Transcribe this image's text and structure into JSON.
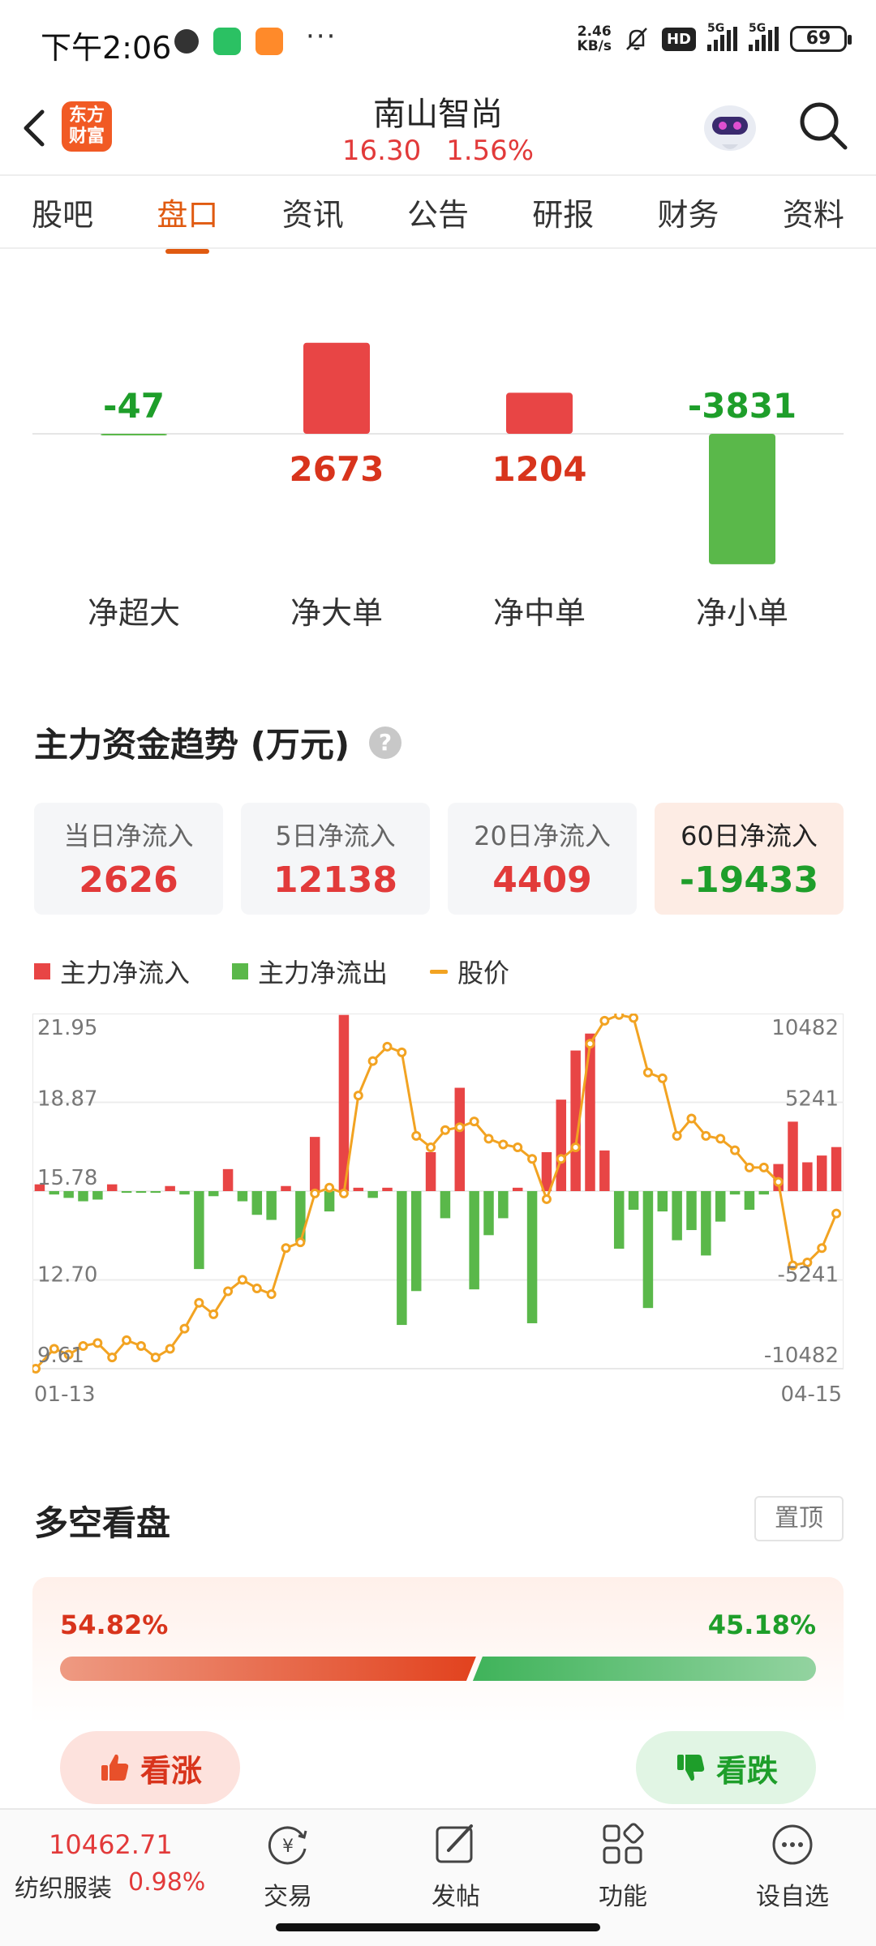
{
  "status_bar": {
    "time": "下午2:06",
    "net_speed_value": "2.46",
    "net_speed_unit": "KB/s",
    "hd_badge": "HD",
    "signal_1_tag": "5G",
    "signal_2_tag": "5G",
    "battery": "69"
  },
  "header": {
    "logo_text": "东方财富",
    "stock_name": "南山智尚",
    "price": "16.30",
    "change_pct": "1.56%"
  },
  "tabs": [
    "股吧",
    "盘口",
    "资讯",
    "公告",
    "研报",
    "财务",
    "资料"
  ],
  "active_tab": "盘口",
  "net_orders": [
    {
      "label": "净超大",
      "value": "-47"
    },
    {
      "label": "净大单",
      "value": "2673"
    },
    {
      "label": "净中单",
      "value": "1204"
    },
    {
      "label": "净小单",
      "value": "-3831"
    }
  ],
  "trend": {
    "title": "主力资金趋势 (万元)",
    "help_icon": "?",
    "cards": [
      {
        "label": "当日净流入",
        "value": "2626"
      },
      {
        "label": "5日净流入",
        "value": "12138"
      },
      {
        "label": "20日净流入",
        "value": "4409"
      },
      {
        "label": "60日净流入",
        "value": "-19433"
      }
    ],
    "legend": {
      "inflow": "主力净流入",
      "outflow": "主力净流出",
      "price": "股价"
    },
    "colors": {
      "red": "#e84545",
      "green": "#5ab84a",
      "price": "#f2a322"
    }
  },
  "chart_data": {
    "type": "bar",
    "x_start": "01-13",
    "x_end": "04-15",
    "left_axis_ticks": [
      "21.95",
      "18.87",
      "15.78",
      "12.70",
      "9.61"
    ],
    "right_axis_ticks": [
      "10482",
      "5241",
      "-5241",
      "-10482"
    ],
    "ylim_price": [
      9.61,
      21.95
    ],
    "ylim_flow": [
      -10482,
      10482
    ],
    "series": [
      {
        "name": "主力净流入/净流出",
        "values": [
          400,
          -200,
          -400,
          -600,
          -500,
          400,
          -100,
          -100,
          -100,
          300,
          -200,
          -4600,
          -300,
          1300,
          -600,
          -1400,
          -1700,
          300,
          -3000,
          3200,
          -1200,
          10400,
          200,
          -400,
          200,
          -7900,
          -5900,
          2300,
          -1600,
          6100,
          -5800,
          -2600,
          -1600,
          200,
          -7800,
          2300,
          5400,
          8300,
          9300,
          2400,
          -3400,
          -1100,
          -6900,
          -1200,
          -2900,
          -2300,
          -3800,
          -1800,
          -200,
          -1100,
          -200,
          1600,
          4100,
          1700,
          2100,
          2600
        ]
      },
      {
        "name": "股价",
        "values": [
          9.61,
          10.3,
          10.1,
          10.4,
          10.5,
          10.0,
          10.6,
          10.4,
          10.0,
          10.3,
          11.0,
          11.9,
          11.5,
          12.3,
          12.7,
          12.4,
          12.2,
          13.8,
          14.0,
          15.7,
          15.9,
          15.7,
          19.1,
          20.3,
          20.8,
          20.6,
          17.7,
          17.3,
          17.9,
          18.0,
          18.2,
          17.6,
          17.4,
          17.3,
          16.9,
          15.5,
          16.9,
          17.3,
          20.9,
          21.7,
          21.9,
          21.8,
          19.9,
          19.7,
          17.7,
          18.3,
          17.7,
          17.6,
          17.2,
          16.6,
          16.6,
          16.1,
          13.2,
          13.3,
          13.8,
          15.0
        ]
      }
    ]
  },
  "long_short": {
    "title": "多空看盘",
    "pin_label": "置顶",
    "bull_pct": "54.82%",
    "bear_pct": "45.18%",
    "bull_ratio": 0.5482,
    "bull_label": "看涨",
    "bear_label": "看跌"
  },
  "bottom_nav": {
    "index_value": "10462.71",
    "index_name": "纺织服装",
    "index_pct": "0.98%",
    "items": [
      {
        "label": "交易",
        "icon": "trade-icon"
      },
      {
        "label": "发帖",
        "icon": "post-icon"
      },
      {
        "label": "功能",
        "icon": "grid-icon"
      },
      {
        "label": "设自选",
        "icon": "more-icon"
      }
    ]
  }
}
